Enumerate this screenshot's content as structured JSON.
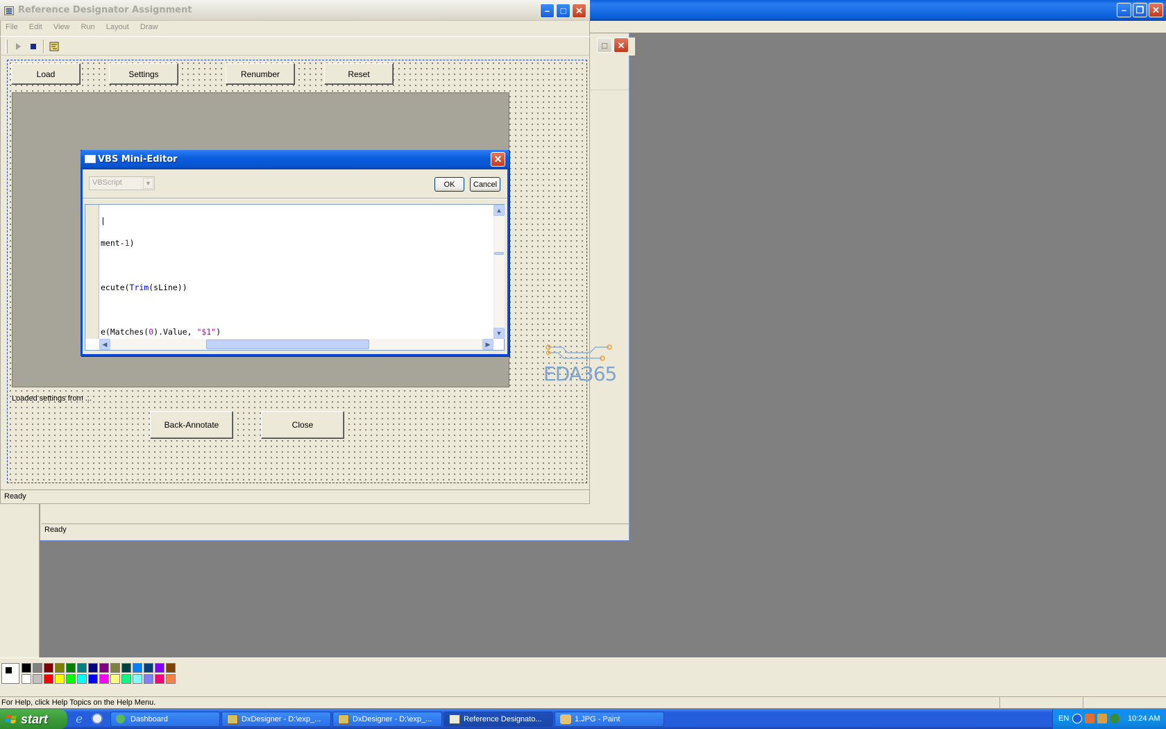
{
  "paint": {
    "title": "1.JPG - Paint",
    "status_help": "For Help, click Help Topics on the Help Menu.",
    "palette_top": [
      "#000000",
      "#808080",
      "#800000",
      "#808000",
      "#008000",
      "#008080",
      "#000080",
      "#800080",
      "#808040",
      "#004040",
      "#0080ff",
      "#004080",
      "#8000ff",
      "#804000"
    ],
    "palette_bottom": [
      "#ffffff",
      "#c0c0c0",
      "#ff0000",
      "#ffff00",
      "#00ff00",
      "#00ffff",
      "#0000ff",
      "#ff00ff",
      "#ffff80",
      "#00ff80",
      "#80ffff",
      "#8080ff",
      "#ff0080",
      "#ff8040"
    ]
  },
  "back_window": {
    "status": "Ready"
  },
  "main_window": {
    "title": "Reference Designator Assignment",
    "menu": [
      "File",
      "Edit",
      "View",
      "Run",
      "Layout",
      "Draw"
    ],
    "buttons": {
      "load": "Load",
      "settings": "Settings",
      "renumber": "Renumber",
      "reset": "Reset",
      "back_annotate": "Back-Annotate",
      "close": "Close"
    },
    "status_line": "Loaded settings from ...",
    "status": "Ready"
  },
  "dialog": {
    "title": "VBS Mini-Editor",
    "language": "VBScript",
    "ok": "OK",
    "cancel": "Cancel"
  },
  "logo": {
    "text": "EDA365",
    "color": "#7fa3cc"
  },
  "taskbar": {
    "start": "start",
    "tasks": [
      {
        "label": "Dashboard"
      },
      {
        "label": "DxDesigner - D:\\exp_..."
      },
      {
        "label": "DxDesigner - D:\\exp_..."
      },
      {
        "label": "Reference Designato..."
      },
      {
        "label": "1.JPG - Paint"
      }
    ],
    "lang": "EN",
    "clock": "10:24 AM"
  },
  "colors": {
    "xp_blue": "#0a5fe0",
    "window_face": "#ece9d8",
    "desktop_gray": "#808080"
  }
}
